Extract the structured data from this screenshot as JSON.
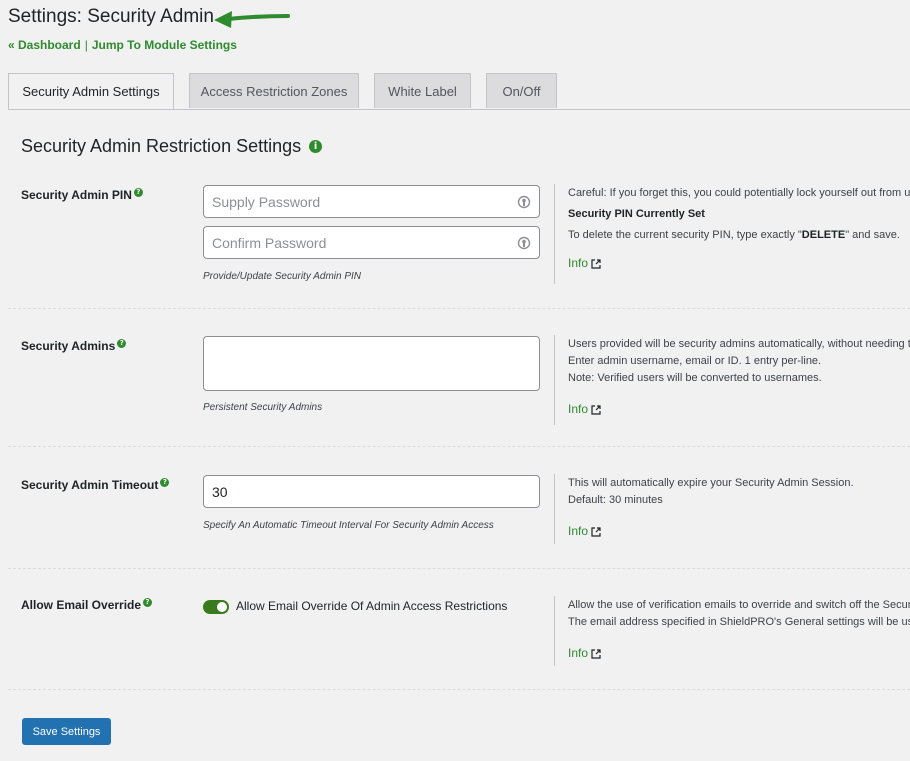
{
  "page": {
    "title": "Settings: Security Admin",
    "links": {
      "dashboard": "« Dashboard",
      "separator": "|",
      "jump": "Jump To Module Settings"
    }
  },
  "tabs": [
    {
      "label": "Security Admin Settings",
      "active": true
    },
    {
      "label": "Access Restriction Zones",
      "active": false
    },
    {
      "label": "White Label",
      "active": false
    },
    {
      "label": "On/Off",
      "active": false
    }
  ],
  "section": {
    "title": "Security Admin Restriction Settings",
    "info_glyph": "i"
  },
  "help_glyph": "?",
  "rows": {
    "pin": {
      "label": "Security Admin PIN",
      "placeholder_password": "Supply Password",
      "placeholder_confirm": "Confirm Password",
      "hint": "Provide/Update Security Admin PIN",
      "desc_line1": "Careful: If you forget this, you could potentially lock yourself out from using this plugin.",
      "desc_line2": "Security PIN Currently Set",
      "desc_line3_pre": "To delete the current security PIN, type exactly \"",
      "desc_line3_bold": "DELETE",
      "desc_line3_post": "\" and save.",
      "info": "Info"
    },
    "admins": {
      "label": "Security Admins",
      "value": "",
      "hint": "Persistent Security Admins",
      "desc_line1": "Users provided will be security admins automatically, without needing the security PIN.",
      "desc_line2": "Enter admin username, email or ID. 1 entry per-line.",
      "desc_line3": "Note: Verified users will be converted to usernames.",
      "info": "Info"
    },
    "timeout": {
      "label": "Security Admin Timeout",
      "value": "30",
      "hint": "Specify An Automatic Timeout Interval For Security Admin Access",
      "desc_line1": "This will automatically expire your Security Admin Session.",
      "desc_line2": "Default: 30 minutes",
      "info": "Info"
    },
    "email": {
      "label": "Allow Email Override",
      "toggle_on": true,
      "toggle_label": "Allow Email Override Of Admin Access Restrictions",
      "desc_line1": "Allow the use of verification emails to override and switch off the Security Admin restrictions.",
      "desc_line2": "The email address specified in ShieldPRO's General settings will be used.",
      "info": "Info"
    }
  },
  "save_button": "Save Settings",
  "colors": {
    "accent_green": "#2e8b2e",
    "primary_blue": "#2271b1",
    "background": "#f1f1f1"
  }
}
